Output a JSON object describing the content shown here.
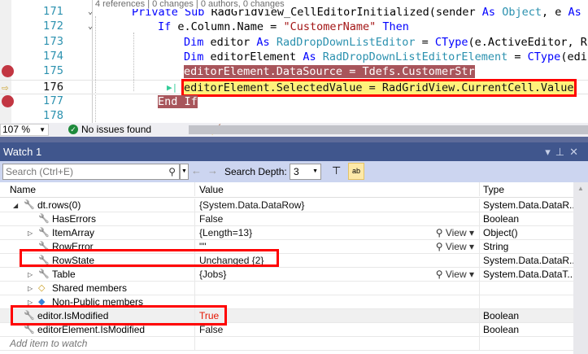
{
  "editor": {
    "codelens": "4 references | 0 changes | 0 authors, 0 changes",
    "lines": [
      {
        "num": "171",
        "tokens": [
          [
            "kw",
            "Private Sub "
          ],
          [
            "",
            "RadGridView_CellEditorInitialized(sender "
          ],
          [
            "kw",
            "As "
          ],
          [
            "ty",
            "Object"
          ],
          [
            "",
            ", e "
          ],
          [
            "kw",
            "As"
          ]
        ]
      },
      {
        "num": "172",
        "tokens": [
          [
            "kw",
            "If "
          ],
          [
            "",
            "e.Column.Name = "
          ],
          [
            "st",
            "\"CustomerName\""
          ],
          [
            "kw",
            " Then"
          ]
        ]
      },
      {
        "num": "173",
        "tokens": [
          [
            "kw",
            "Dim "
          ],
          [
            "",
            "editor "
          ],
          [
            "kw",
            "As "
          ],
          [
            "ty",
            "RadDropDownListEditor"
          ],
          [
            "",
            " = "
          ],
          [
            "kw",
            "CType"
          ],
          [
            "",
            "(e.ActiveEditor, R"
          ]
        ]
      },
      {
        "num": "174",
        "tokens": [
          [
            "kw",
            "Dim "
          ],
          [
            "",
            "editorElement "
          ],
          [
            "kw",
            "As "
          ],
          [
            "ty",
            "RadDropDownListEditorElement"
          ],
          [
            "",
            " = "
          ],
          [
            "kw",
            "CType"
          ],
          [
            "",
            "(edi"
          ]
        ]
      },
      {
        "num": "175",
        "tokens": [
          [
            "bp",
            "editorElement.DataSource = Tdefs.CustomerStr"
          ]
        ]
      },
      {
        "num": "176",
        "tokens": [
          [
            "cur",
            "editorElement.SelectedValue = RadGridView.CurrentCell.Value"
          ]
        ]
      },
      {
        "num": "177",
        "tokens": [
          [
            "bp",
            "End If"
          ]
        ]
      },
      {
        "num": "178",
        "tokens": []
      }
    ]
  },
  "status": {
    "zoom": "107 %",
    "issues": "No issues found"
  },
  "watch": {
    "title": "Watch 1",
    "search_placeholder": "Search (Ctrl+E)",
    "search_depth_label": "Search Depth:",
    "search_depth": "3",
    "columns": [
      "Name",
      "Value",
      "Type"
    ],
    "view_label": "View",
    "rows": [
      {
        "name": "dt.rows(0)",
        "value": "{System.Data.DataRow}",
        "type": "System.Data.DataR...",
        "level": 0,
        "expander": "expanded",
        "icon": "wrench-icon"
      },
      {
        "name": "HasErrors",
        "value": "False",
        "type": "Boolean",
        "level": 1,
        "expander": "",
        "icon": "wrench-icon"
      },
      {
        "name": "ItemArray",
        "value": "{Length=13}",
        "type": "Object()",
        "level": 1,
        "expander": "collapsed",
        "icon": "wrench-icon",
        "view": true
      },
      {
        "name": "RowError",
        "value": "\"\"",
        "type": "String",
        "level": 1,
        "expander": "",
        "icon": "wrench-icon",
        "view": true
      },
      {
        "name": "RowState",
        "value": "Unchanged {2}",
        "type": "System.Data.DataR...",
        "level": 1,
        "expander": "",
        "icon": "wrench-icon"
      },
      {
        "name": "Table",
        "value": "{Jobs}",
        "type": "System.Data.DataT...",
        "level": 1,
        "expander": "collapsed",
        "icon": "wrench-icon",
        "view": true
      },
      {
        "name": "Shared members",
        "value": "",
        "type": "",
        "level": 1,
        "expander": "collapsed",
        "icon": "shared-members-icon"
      },
      {
        "name": "Non-Public members",
        "value": "",
        "type": "",
        "level": 1,
        "expander": "collapsed",
        "icon": "non-public-icon"
      },
      {
        "name": "editor.IsModified",
        "value": "True",
        "type": "Boolean",
        "level": 0,
        "expander": "",
        "icon": "wrench-icon",
        "changed": true
      },
      {
        "name": "editorElement.IsModified",
        "value": "False",
        "type": "Boolean",
        "level": 0,
        "expander": "",
        "icon": "wrench-icon"
      }
    ],
    "add_placeholder": "Add item to watch"
  },
  "colors": {
    "breakpoint": "#c23642",
    "current_line": "#fff27b",
    "highlight_box": "#ff0000",
    "changed_value": "#e51400",
    "title_bar": "#40568d"
  }
}
